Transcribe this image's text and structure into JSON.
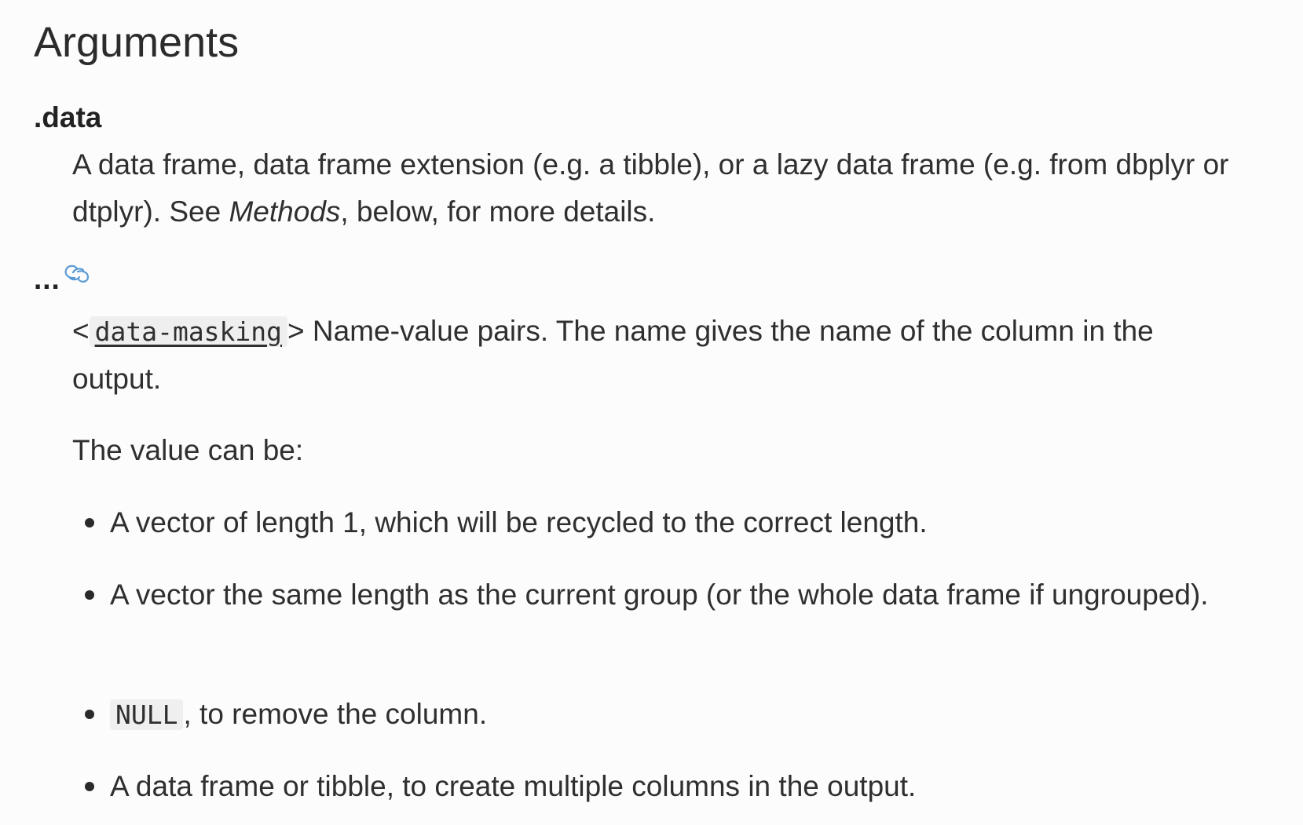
{
  "heading": "Arguments",
  "arguments": [
    {
      "name": ".data",
      "description_parts": [
        "A data frame, data frame extension (e.g. a tibble), or a lazy data frame (e.g. from dbplyr or dtplyr). See ",
        "Methods",
        ", below, for more details."
      ]
    },
    {
      "name": "...",
      "anchor_icon": "link-icon",
      "description": {
        "open_bracket": "<",
        "code_link": "data-masking",
        "close_bracket": ">",
        "text": " Name-value pairs. The name gives the name of the column in the output."
      },
      "value_intro": "The value can be:",
      "values": [
        {
          "text": "A vector of length 1, which will be recycled to the correct length."
        },
        {
          "text": "A vector the same length as the current group (or the whole data frame if ungrouped)."
        },
        {
          "code": "NULL",
          "text": ", to remove the column."
        },
        {
          "text": "A data frame or tibble, to create multiple columns in the output."
        }
      ]
    }
  ],
  "colors": {
    "text": "#2f2f2f",
    "code_background": "#efefef",
    "link_icon": "#5a9bd5"
  }
}
